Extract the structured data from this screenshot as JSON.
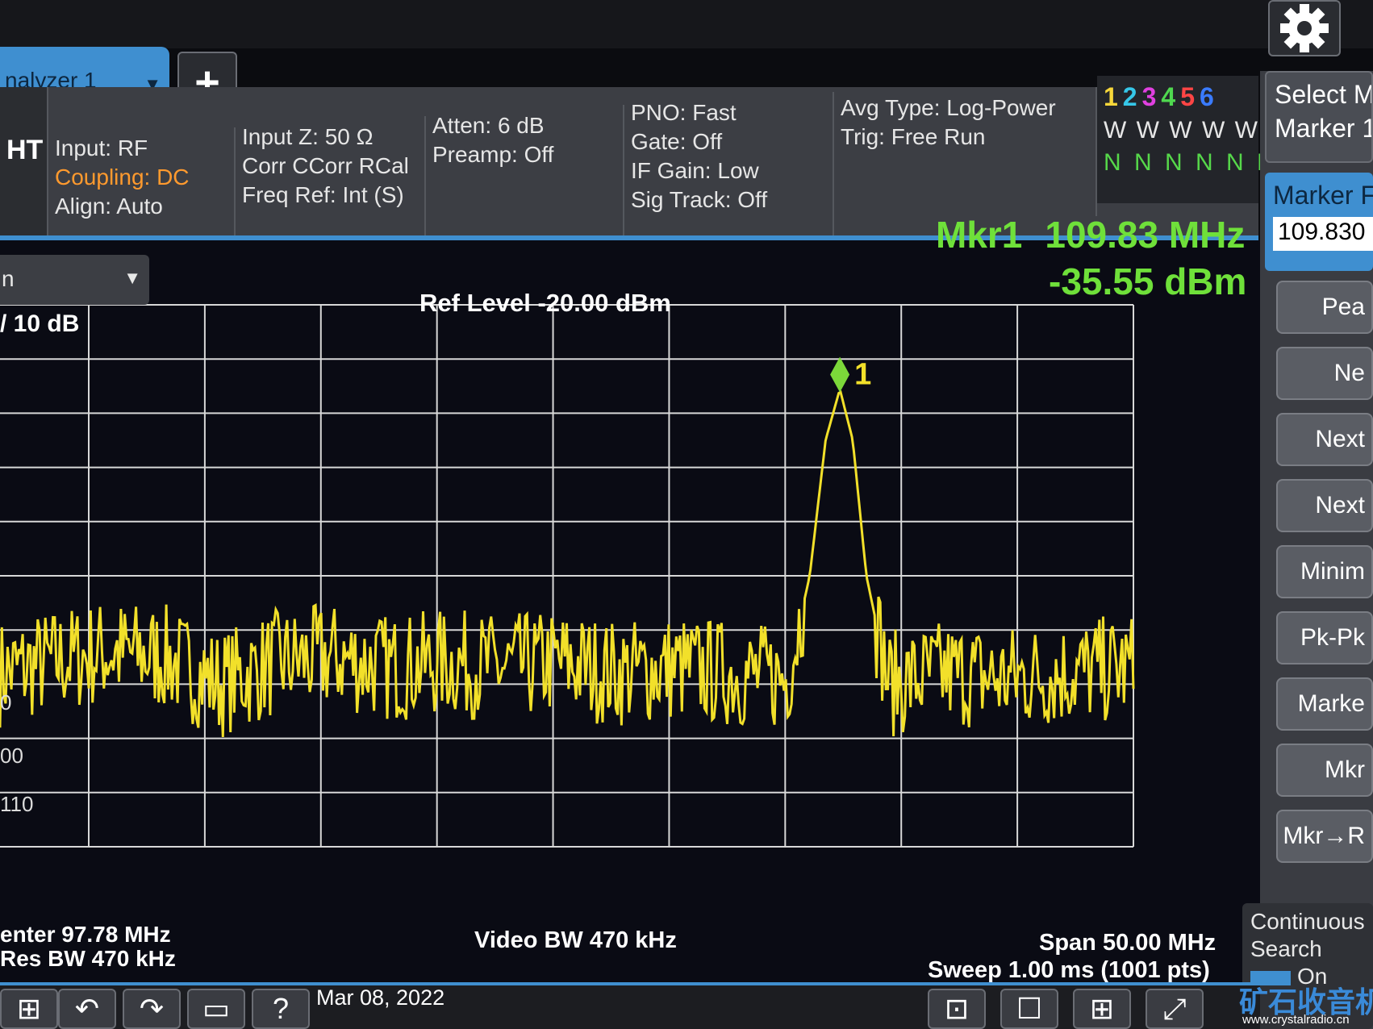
{
  "tabs": {
    "active_label": "nalyzer 1",
    "add_label": "+"
  },
  "settings": {
    "mode_label": "HT",
    "input": {
      "line1": "Input: RF",
      "line2": "Coupling: DC",
      "line3": "Align: Auto"
    },
    "impedance": {
      "line1": "Input Z: 50 Ω",
      "line2": "Corr CCorr RCal",
      "line3": "Freq Ref: Int (S)"
    },
    "attenuation": {
      "line1": "Atten: 6 dB",
      "line2": "Preamp: Off"
    },
    "sweep_settings": {
      "line1": "PNO: Fast",
      "line2": "Gate: Off",
      "line3": "IF Gain: Low",
      "line4": "Sig Track: Off"
    },
    "averaging": {
      "line1": "Avg Type: Log-Power",
      "line2": "Trig: Free Run"
    },
    "traces": {
      "numbers": [
        "1",
        "2",
        "3",
        "4",
        "5",
        "6"
      ],
      "number_colors": [
        "#f6d73a",
        "#36c7e8",
        "#e040e0",
        "#4fd84f",
        "#ff4545",
        "#3a7bff"
      ],
      "types": "W W W W W W",
      "detectors": "N N N N N N"
    }
  },
  "marker_readout": {
    "name": "Mkr1",
    "frequency": "109.83 MHz",
    "amplitude": "-35.55 dBm"
  },
  "scale": {
    "dropdown_text": "n",
    "per_div": "/ 10 dB"
  },
  "ref_level": "Ref Level -20.00 dBm",
  "y_axis_partial_ticks": [
    "0",
    "00",
    "110"
  ],
  "bottom": {
    "center": "enter 97.78 MHz",
    "res_bw": "Res BW 470 kHz",
    "video_bw": "Video BW 470 kHz",
    "span": "Span 50.00 MHz",
    "sweep": "Sweep 1.00 ms (1001 pts)"
  },
  "softkeys": {
    "select_marker": "Select M",
    "select_marker_value": "Marker 1",
    "marker_freq_label": "Marker F",
    "marker_freq_value": "109.830",
    "buttons": [
      "Pea",
      "Ne",
      "Next",
      "Next",
      "Minim",
      "Pk-Pk",
      "Marke",
      "Mkr",
      "Mkr→R"
    ],
    "continuous_search_line1": "Continuous",
    "continuous_search_line2": "Search",
    "continuous_search_state": "On"
  },
  "taskbar": {
    "date": "Mar 08, 2022"
  },
  "watermark": {
    "text": "矿石收音机",
    "url": "www.crystalradio.cn"
  },
  "colors": {
    "trace": "#f2e02a",
    "grid": "#d8d8d8",
    "marker_readout": "#6fe03a",
    "accent": "#3f8fd0"
  },
  "chart_data": {
    "type": "line",
    "title": "",
    "xlabel": "",
    "ylabel": "",
    "x_unit": "MHz",
    "y_unit": "dBm",
    "xlim": [
      72.78,
      122.78
    ],
    "ylim": [
      -120,
      -20
    ],
    "grid": true,
    "y_divisions": 10,
    "x_divisions": 10,
    "series": [
      {
        "name": "1",
        "x": [
          72.78,
          75.0,
          77.5,
          80.0,
          82.5,
          85.0,
          87.5,
          90.0,
          92.5,
          95.0,
          97.5,
          100.0,
          102.5,
          105.0,
          107.5,
          108.5,
          109.2,
          109.83,
          110.4,
          111.0,
          112.0,
          114.5,
          117.0,
          119.5,
          122.78
        ],
        "y": [
          -88,
          -86,
          -84,
          -85,
          -90,
          -86,
          -85,
          -87,
          -86,
          -87,
          -86,
          -88,
          -87,
          -88,
          -89,
          -70,
          -45,
          -35.55,
          -45,
          -70,
          -90,
          -88,
          -89,
          -88,
          -87
        ]
      }
    ],
    "markers": [
      {
        "label": "1",
        "x": 109.83,
        "y": -35.55
      }
    ]
  }
}
